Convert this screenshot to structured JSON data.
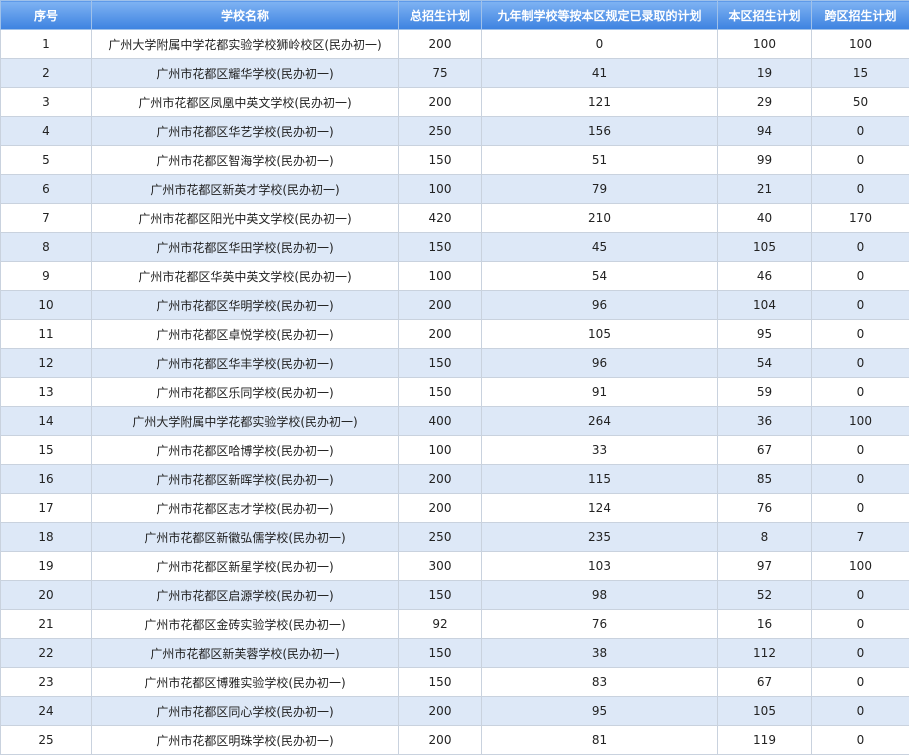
{
  "table": {
    "headers": [
      "序号",
      "学校名称",
      "总招生计划",
      "九年制学校等按本区规定已录取的计划",
      "本区招生计划",
      "跨区招生计划"
    ],
    "rows": [
      [
        "1",
        "广州大学附属中学花都实验学校狮岭校区(民办初一)",
        "200",
        "0",
        "100",
        "100"
      ],
      [
        "2",
        "广州市花都区耀华学校(民办初一)",
        "75",
        "41",
        "19",
        "15"
      ],
      [
        "3",
        "广州市花都区凤凰中英文学校(民办初一)",
        "200",
        "121",
        "29",
        "50"
      ],
      [
        "4",
        "广州市花都区华艺学校(民办初一)",
        "250",
        "156",
        "94",
        "0"
      ],
      [
        "5",
        "广州市花都区智海学校(民办初一)",
        "150",
        "51",
        "99",
        "0"
      ],
      [
        "6",
        "广州市花都区新英才学校(民办初一)",
        "100",
        "79",
        "21",
        "0"
      ],
      [
        "7",
        "广州市花都区阳光中英文学校(民办初一)",
        "420",
        "210",
        "40",
        "170"
      ],
      [
        "8",
        "广州市花都区华田学校(民办初一)",
        "150",
        "45",
        "105",
        "0"
      ],
      [
        "9",
        "广州市花都区华英中英文学校(民办初一)",
        "100",
        "54",
        "46",
        "0"
      ],
      [
        "10",
        "广州市花都区华明学校(民办初一)",
        "200",
        "96",
        "104",
        "0"
      ],
      [
        "11",
        "广州市花都区卓悦学校(民办初一)",
        "200",
        "105",
        "95",
        "0"
      ],
      [
        "12",
        "广州市花都区华丰学校(民办初一)",
        "150",
        "96",
        "54",
        "0"
      ],
      [
        "13",
        "广州市花都区乐同学校(民办初一)",
        "150",
        "91",
        "59",
        "0"
      ],
      [
        "14",
        "广州大学附属中学花都实验学校(民办初一)",
        "400",
        "264",
        "36",
        "100"
      ],
      [
        "15",
        "广州市花都区哈博学校(民办初一)",
        "100",
        "33",
        "67",
        "0"
      ],
      [
        "16",
        "广州市花都区新晖学校(民办初一)",
        "200",
        "115",
        "85",
        "0"
      ],
      [
        "17",
        "广州市花都区志才学校(民办初一)",
        "200",
        "124",
        "76",
        "0"
      ],
      [
        "18",
        "广州市花都区新徽弘儒学校(民办初一)",
        "250",
        "235",
        "8",
        "7"
      ],
      [
        "19",
        "广州市花都区新星学校(民办初一)",
        "300",
        "103",
        "97",
        "100"
      ],
      [
        "20",
        "广州市花都区启源学校(民办初一)",
        "150",
        "98",
        "52",
        "0"
      ],
      [
        "21",
        "广州市花都区金砖实验学校(民办初一)",
        "92",
        "76",
        "16",
        "0"
      ],
      [
        "22",
        "广州市花都区新芙蓉学校(民办初一)",
        "150",
        "38",
        "112",
        "0"
      ],
      [
        "23",
        "广州市花都区博雅实验学校(民办初一)",
        "150",
        "83",
        "67",
        "0"
      ],
      [
        "24",
        "广州市花都区同心学校(民办初一)",
        "200",
        "95",
        "105",
        "0"
      ],
      [
        "25",
        "广州市花都区明珠学校(民办初一)",
        "200",
        "81",
        "119",
        "0"
      ]
    ]
  }
}
